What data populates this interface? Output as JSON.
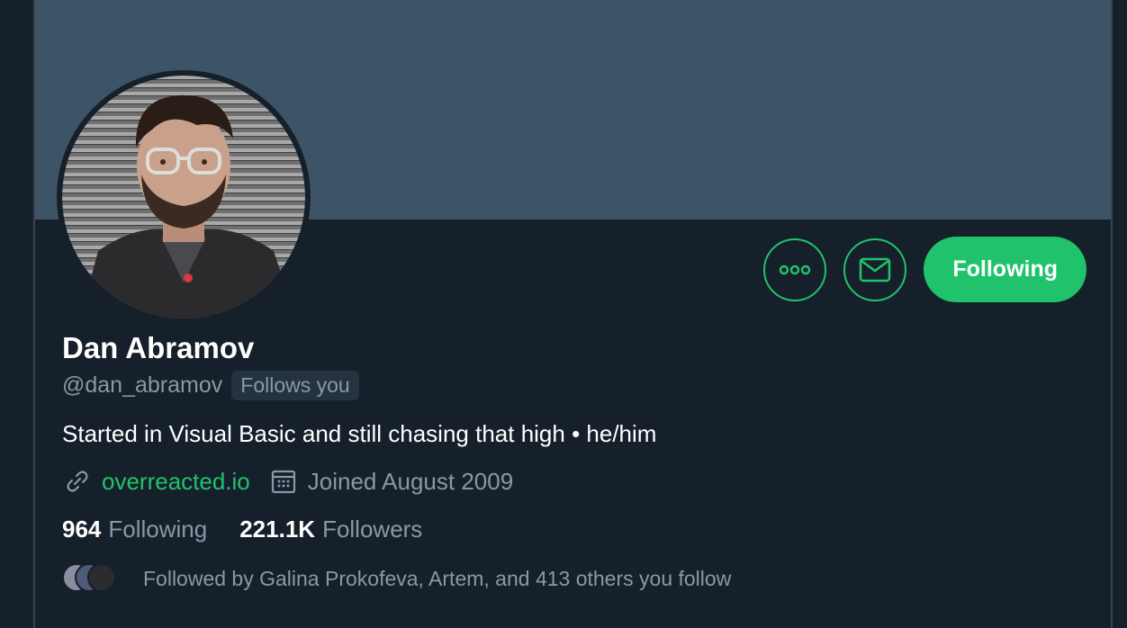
{
  "profile": {
    "name": "Dan Abramov",
    "handle": "@dan_abramov",
    "follows_you_badge": "Follows you",
    "bio": "Started in Visual Basic and still chasing that high • he/him",
    "website": "overreacted.io",
    "joined": "Joined August 2009",
    "following_count": "964",
    "following_label": "Following",
    "followers_count": "221.1K",
    "followers_label": "Followers",
    "followed_by": "Followed by Galina Prokofeva, Artem, and 413 others you follow"
  },
  "actions": {
    "more_icon": "more-icon",
    "message_icon": "mail-icon",
    "follow_button_label": "Following"
  },
  "colors": {
    "accent": "#20c36b",
    "banner": "#3d5466",
    "background": "#15202b",
    "muted_text": "#8899a6"
  }
}
